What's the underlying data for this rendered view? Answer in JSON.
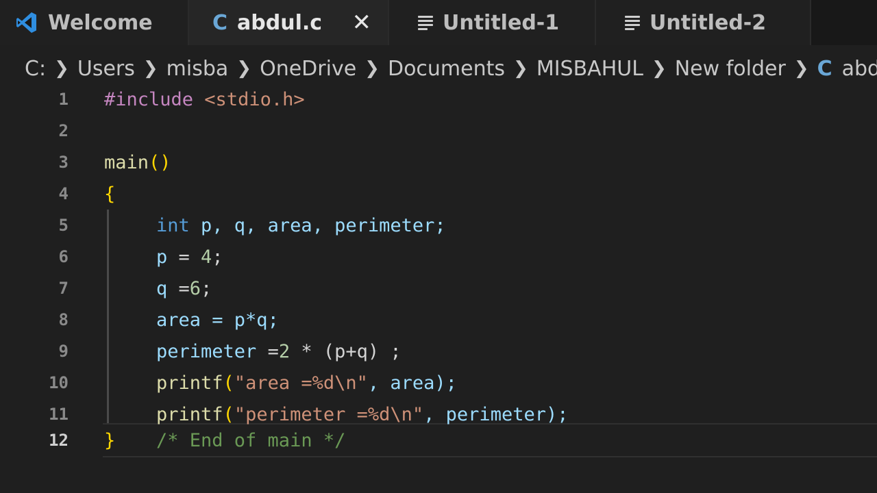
{
  "tabs": [
    {
      "label": "Welcome",
      "icon": "vscode-logo-icon"
    },
    {
      "label": "abdul.c",
      "icon": "c-file-icon",
      "close": "✕",
      "active": true
    },
    {
      "label": "Untitled-1",
      "icon": "text-file-icon"
    },
    {
      "label": "Untitled-2",
      "icon": "text-file-icon"
    }
  ],
  "file_icon_letter": "C",
  "breadcrumb": [
    "C:",
    "Users",
    "misba",
    "OneDrive",
    "Documents",
    "MISBAHUL",
    "New folder",
    "abdul.c"
  ],
  "line_numbers": [
    "1",
    "2",
    "3",
    "4",
    "5",
    "6",
    "7",
    "8",
    "9",
    "10",
    "11",
    "12"
  ],
  "code": {
    "l1_pp": "#include",
    "l1_str": " <stdio.h>",
    "l3_fn": "main",
    "l3_paren": "()",
    "l4_brace": "{",
    "l5_kw": "int",
    "l5_rest": " p, q, area, perimeter;",
    "l6_var": "p",
    "l6_op": " = ",
    "l6_num": "4",
    "l6_end": ";",
    "l7_var": "q",
    "l7_op": " =",
    "l7_num": "6",
    "l7_end": ";",
    "l8_var": "area",
    "l8_rest": " = p*q;",
    "l9_var": "perimeter",
    "l9_op": " =",
    "l9_num": "2",
    "l9_rest": " * (p+q) ;",
    "l10_fn": "printf",
    "l10_open": "(",
    "l10_str": "\"area =%d\\n\"",
    "l10_rest": ", area);",
    "l11_fn": "printf",
    "l11_open": "(",
    "l11_str": "\"perimeter =%d\\n\"",
    "l11_rest": ", perimeter);",
    "l12_brace": "}",
    "l12_cmt": "/* End of main */"
  },
  "colors": {
    "preprocessor": "#c586c0",
    "string": "#ce9178",
    "function": "#dcdcaa",
    "brace": "#ffd700",
    "keyword": "#569cd6",
    "variable": "#9cdcfe",
    "number": "#b5cea8",
    "comment": "#6a9955"
  }
}
